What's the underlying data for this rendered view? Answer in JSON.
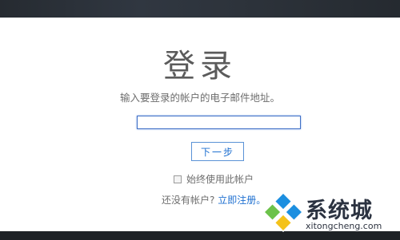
{
  "login": {
    "title": "登录",
    "subtitle": "输入要登录的帐户的电子邮件地址。",
    "email_value": "",
    "next_button": "下一步",
    "remember_label": "始终使用此帐户",
    "no_account_text": "还没有帐户?",
    "signup_link": "立即注册。"
  },
  "watermark": {
    "text_cn": "系统城",
    "text_en": "xitongcheng.com",
    "icon": "diamond-logo-icon"
  },
  "colors": {
    "accent": "#1d6fd0",
    "input_border": "#3f6fc6",
    "frame": "#1e2226",
    "logo_blue": "#1c8fe0",
    "logo_green": "#6cc24a",
    "logo_yellow": "#f4c21a"
  }
}
